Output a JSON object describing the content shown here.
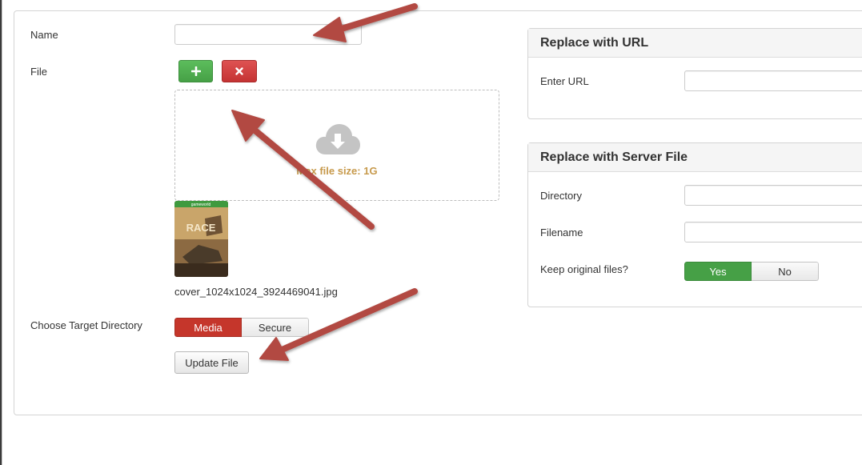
{
  "form": {
    "name_label": "Name",
    "name_value": "",
    "file_label": "File",
    "add_button_icon": "plus-icon",
    "remove_button_icon": "times-icon",
    "dropzone": {
      "icon": "cloud-download-icon",
      "max_size_text": "Max file size: 1G"
    },
    "thumbnail": {
      "title_line1": "RACE",
      "brand": "gameworld"
    },
    "filename": "cover_1024x1024_3924469041.jpg",
    "target_dir_label": "Choose Target Directory",
    "target_options": [
      "Media",
      "Secure"
    ],
    "target_selected": "Media",
    "update_button": "Update File"
  },
  "replace_url": {
    "title": "Replace with URL",
    "url_label": "Enter URL",
    "url_value": ""
  },
  "replace_server": {
    "title": "Replace with Server File",
    "directory_label": "Directory",
    "directory_value": "",
    "filename_label": "Filename",
    "filename_value": "",
    "keep_label": "Keep original files?",
    "keep_options": [
      "Yes",
      "No"
    ],
    "keep_selected": "Yes"
  },
  "colors": {
    "accent_red": "#c5362b",
    "accent_green": "#46a046",
    "annotation_arrow": "#b24a43",
    "dropzone_text": "#c79a4c"
  }
}
